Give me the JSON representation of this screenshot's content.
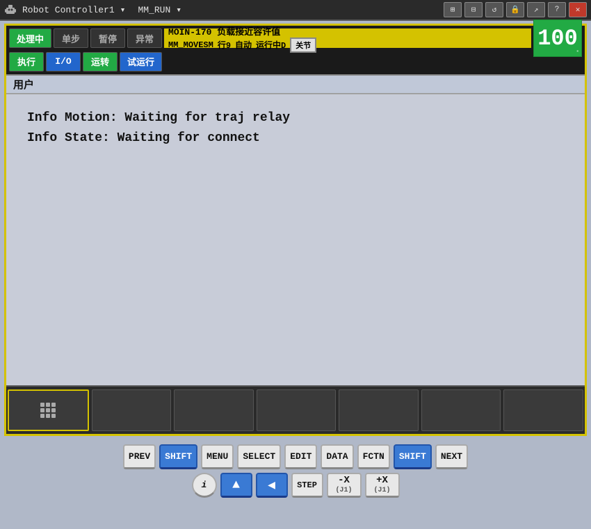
{
  "titlebar": {
    "robot_name": "Robot Controller1",
    "mode": "MM_RUN",
    "icon_label": "robot",
    "close_label": "✕",
    "help_label": "?",
    "restore_label": "❐",
    "minimize_label": "—",
    "lock_label": "🔒",
    "arrow_label": "↗"
  },
  "status": {
    "btn1": "处理中",
    "btn2": "单步",
    "btn3": "暂停",
    "btn4": "异常",
    "info_line1": "MOIN-170 负载接近容许值",
    "info_line2_a": "MM_MOVESM",
    "info_line2_b": "行9",
    "info_line2_c": "自动",
    "info_line2_d": "运行中D",
    "guanjie": "关节",
    "score": "100",
    "btn5": "执行",
    "btn6": "I/O",
    "btn7": "运转",
    "btn8": "试运行"
  },
  "user_label": "用户",
  "display": {
    "line1": "Info Motion: Waiting for traj relay",
    "line2": "Info State: Waiting for connect"
  },
  "toolbar": {
    "grid_btn": "grid",
    "btn2": "",
    "btn3": "",
    "btn4": "",
    "btn5": "",
    "btn6": "",
    "btn7": ""
  },
  "keyboard": {
    "row1": [
      "PREV",
      "SHIFT",
      "MENU",
      "SELECT",
      "EDIT",
      "DATA",
      "FCTN",
      "SHIFT",
      "NEXT"
    ],
    "row2_info": "i",
    "row2_up": "▲",
    "row2_left": "◀",
    "step": "STEP",
    "xj_minus": "-X\n(J1)",
    "xj_plus": "+X\n(J1)"
  }
}
